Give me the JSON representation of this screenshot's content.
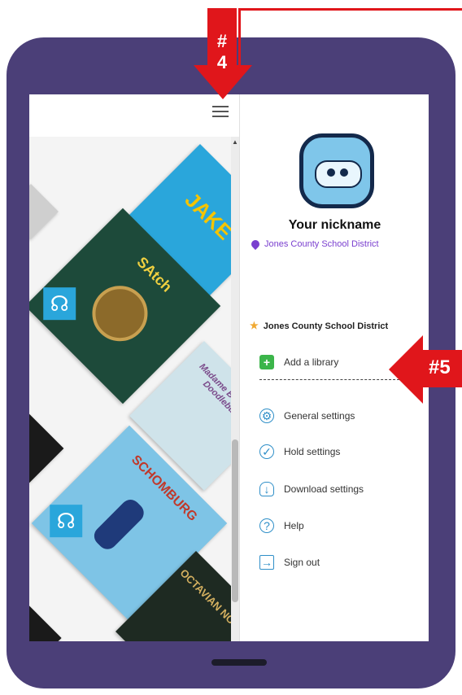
{
  "annotations": {
    "arrow4_line1": "#",
    "arrow4_line2": "4",
    "arrow5": "#5"
  },
  "profile": {
    "nickname": "Your nickname",
    "library": "Jones County School District"
  },
  "libraries": {
    "current": "Jones County School District"
  },
  "menu": {
    "add_library": "Add a library",
    "general_settings": "General settings",
    "hold_settings": "Hold settings",
    "download_settings": "Download settings",
    "help": "Help",
    "sign_out": "Sign out"
  },
  "books": {
    "jake": "JAKE",
    "satchmo": "SAtch",
    "madame": "Madame Beautiful Doodlebug",
    "schomberg": "SCHOMBURG",
    "octavian": "OCTAVIAN NOTHING"
  },
  "colors": {
    "accent": "#7a3fcf",
    "annotation": "#e0161b",
    "tablet": "#4b3f78",
    "icon": "#2f8fc8"
  },
  "icons": [
    "menu-icon",
    "pin-icon",
    "star-icon",
    "plus-icon",
    "gear-icon",
    "check-icon",
    "cloud-icon",
    "help-icon",
    "sign-out-icon",
    "headphones-icon"
  ]
}
